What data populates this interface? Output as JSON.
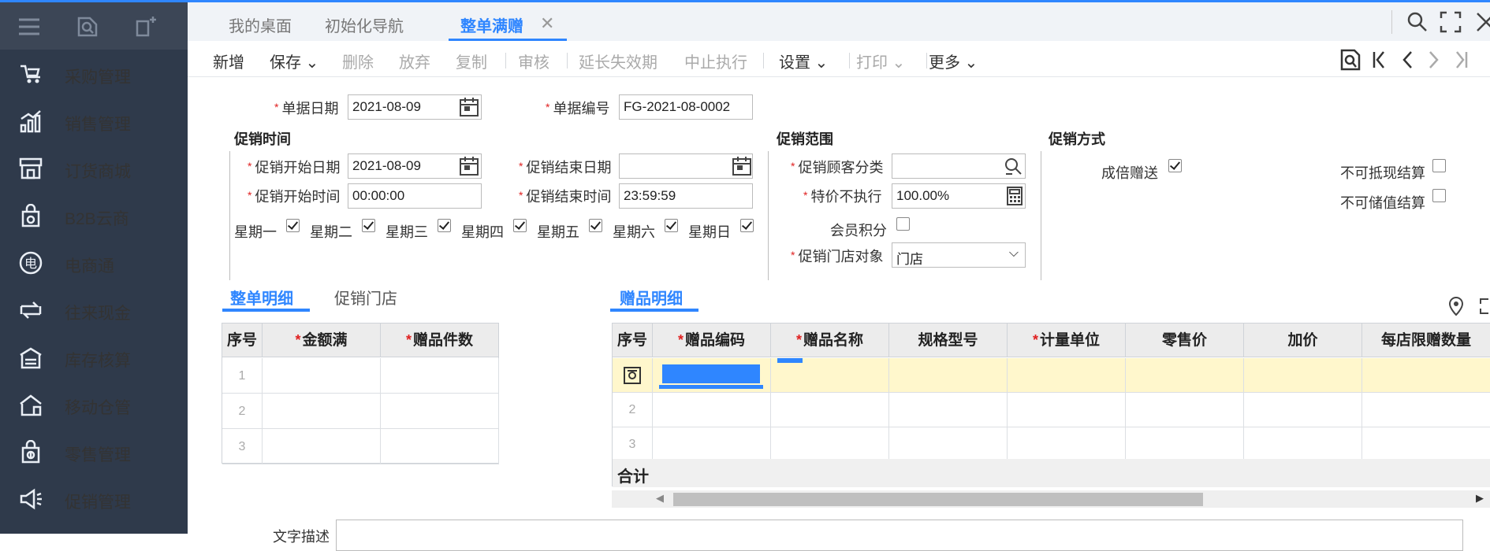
{
  "sidebar": {
    "items": [
      {
        "label": "采购管理",
        "icon": "purchase-cart-icon"
      },
      {
        "label": "销售管理",
        "icon": "sales-chart-icon"
      },
      {
        "label": "订货商城",
        "icon": "store-icon"
      },
      {
        "label": "B2B云商",
        "icon": "cloud-bag-icon"
      },
      {
        "label": "电商通",
        "icon": "ecommerce-icon"
      },
      {
        "label": "往来现金",
        "icon": "cash-flow-icon"
      },
      {
        "label": "库存核算",
        "icon": "inventory-icon"
      },
      {
        "label": "移动仓管",
        "icon": "mobile-warehouse-icon"
      },
      {
        "label": "零售管理",
        "icon": "retail-icon"
      },
      {
        "label": "促销管理",
        "icon": "promotion-megaphone-icon"
      }
    ]
  },
  "tabs": [
    {
      "label": "我的桌面"
    },
    {
      "label": "初始化导航"
    },
    {
      "label": "整单满赠"
    }
  ],
  "toolbar": {
    "buttons": [
      "新增",
      "保存",
      "删除",
      "放弃",
      "复制",
      "审核",
      "延长失效期",
      "中止执行",
      "设置",
      "打印",
      "更多"
    ]
  },
  "form": {
    "doc_date_label": "单据日期",
    "doc_date": "2021-08-09",
    "doc_no_label": "单据编号",
    "doc_no": "FG-2021-08-0002",
    "section_time": "促销时间",
    "section_scope": "促销范围",
    "section_method": "促销方式",
    "start_date_label": "促销开始日期",
    "start_date": "2021-08-09",
    "end_date_label": "促销结束日期",
    "end_date": "",
    "start_time_label": "促销开始时间",
    "start_time": "00:00:00",
    "end_time_label": "促销结束时间",
    "end_time": "23:59:59",
    "weekdays": [
      "星期一",
      "星期二",
      "星期三",
      "星期四",
      "星期五",
      "星期六",
      "星期日"
    ],
    "customer_cat_label": "促销顾客分类",
    "customer_cat": "",
    "special_price_label": "特价不执行",
    "special_price": "100.00%",
    "member_points_label": "会员积分",
    "store_target_label": "促销门店对象",
    "store_target": "门店",
    "multiple_gift_label": "成倍赠送",
    "no_cash_offset_label": "不可抵现结算",
    "no_stored_value_label": "不可储值结算"
  },
  "detail_tabs": {
    "left": [
      "整单明细",
      "促销门店"
    ],
    "right": "赠品明细"
  },
  "left_grid": {
    "headers": [
      "序号",
      "金额满",
      "赠品件数"
    ],
    "rows": [
      "1",
      "2",
      "3"
    ]
  },
  "right_grid": {
    "headers": [
      "序号",
      "赠品编码",
      "赠品名称",
      "规格型号",
      "计量单位",
      "零售价",
      "加价",
      "每店限赠数量"
    ],
    "rows": [
      "",
      "2",
      "3"
    ],
    "total_label": "合计"
  },
  "bottom": {
    "remark_label": "文字描述"
  }
}
